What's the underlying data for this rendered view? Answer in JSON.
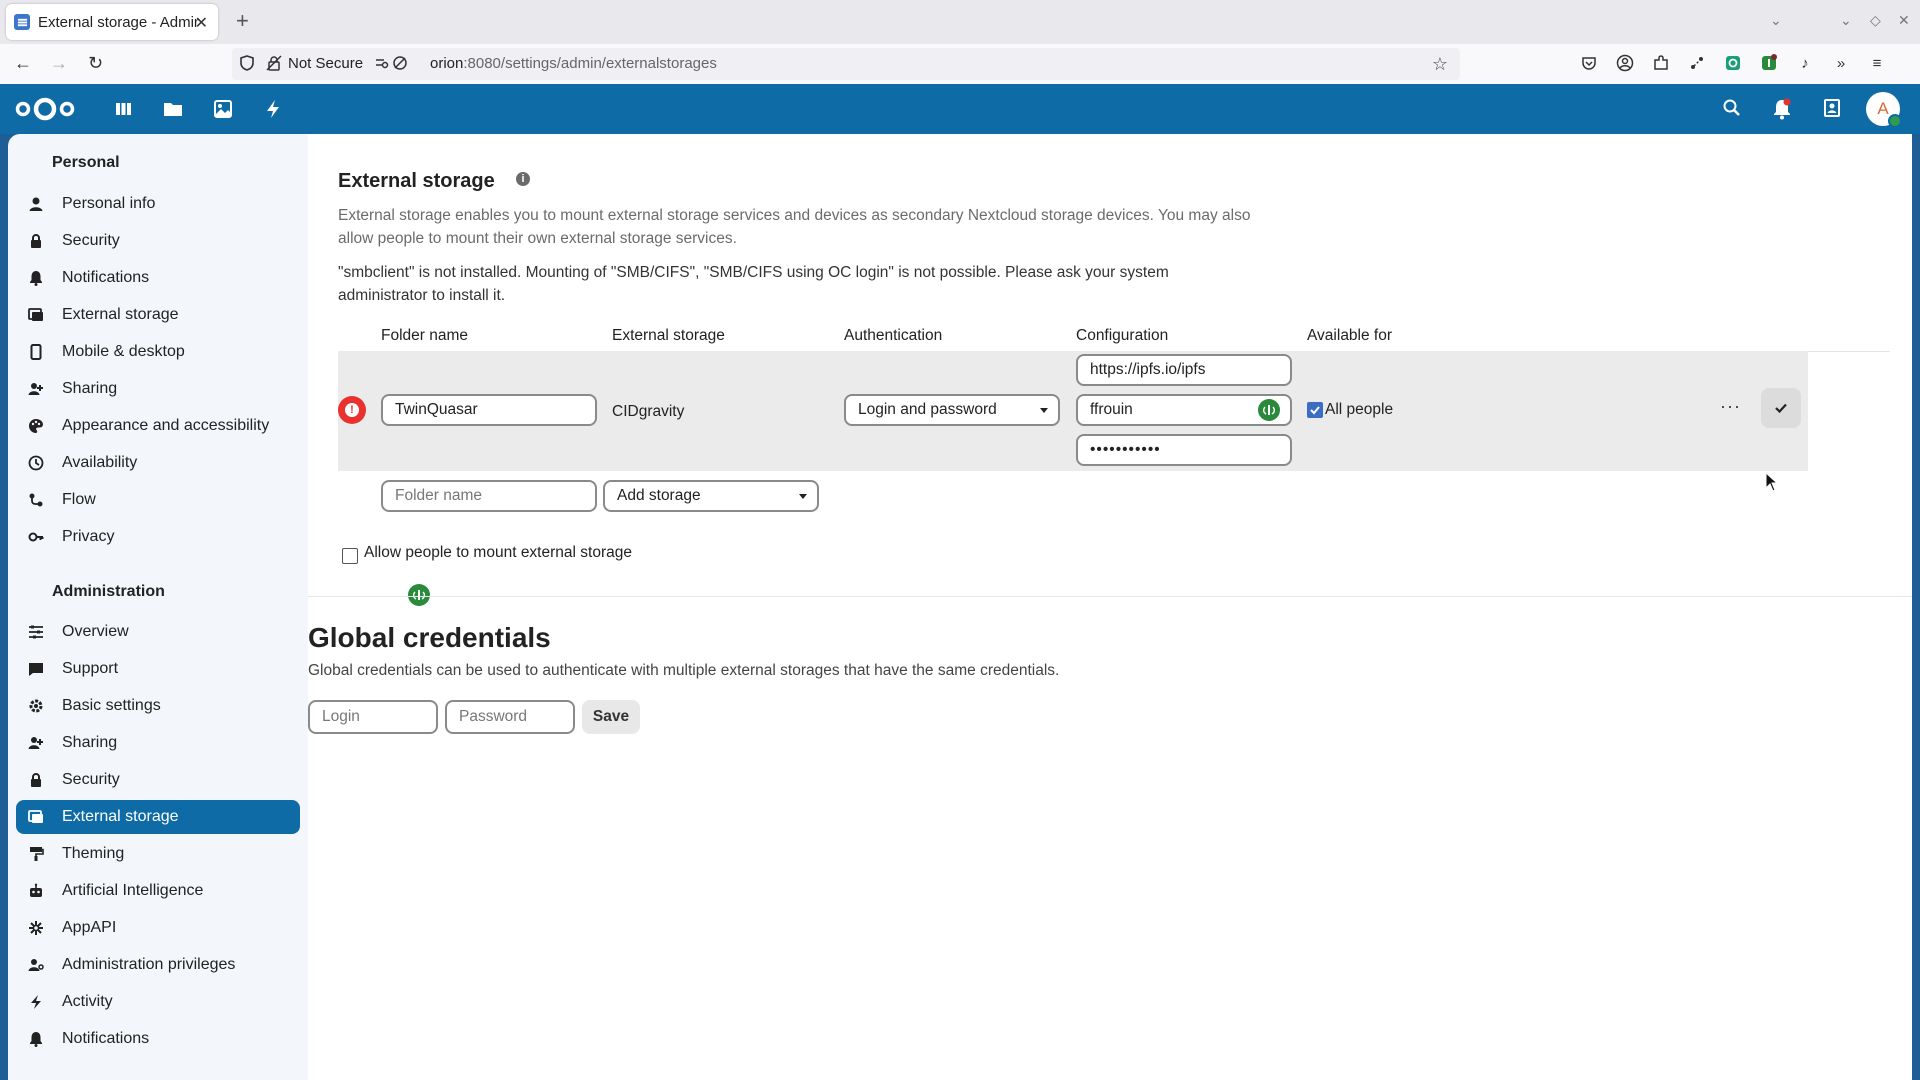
{
  "browser": {
    "tab_title": "External storage - Administ",
    "url_security": "Not Secure",
    "url_host": "orion",
    "url_rest": ":8080/settings/admin/externalstorages"
  },
  "header": {
    "avatar_letter": "A"
  },
  "sidebar": {
    "personal_heading": "Personal",
    "personal_items": [
      {
        "label": "Personal info",
        "icon": "person-icon"
      },
      {
        "label": "Security",
        "icon": "lock-icon"
      },
      {
        "label": "Notifications",
        "icon": "bell-icon"
      },
      {
        "label": "External storage",
        "icon": "external-storage-icon"
      },
      {
        "label": "Mobile & desktop",
        "icon": "phone-icon"
      },
      {
        "label": "Sharing",
        "icon": "share-icon"
      },
      {
        "label": "Appearance and accessibility",
        "icon": "palette-icon"
      },
      {
        "label": "Availability",
        "icon": "clock-icon"
      },
      {
        "label": "Flow",
        "icon": "flow-icon"
      },
      {
        "label": "Privacy",
        "icon": "key-icon"
      }
    ],
    "admin_heading": "Administration",
    "admin_items": [
      {
        "label": "Overview",
        "icon": "overview-icon"
      },
      {
        "label": "Support",
        "icon": "support-icon"
      },
      {
        "label": "Basic settings",
        "icon": "settings-icon"
      },
      {
        "label": "Sharing",
        "icon": "share-icon"
      },
      {
        "label": "Security",
        "icon": "lock-icon"
      },
      {
        "label": "External storage",
        "icon": "external-storage-icon",
        "active": true
      },
      {
        "label": "Theming",
        "icon": "brush-icon"
      },
      {
        "label": "Artificial Intelligence",
        "icon": "robot-icon"
      },
      {
        "label": "AppAPI",
        "icon": "appapi-icon"
      },
      {
        "label": "Administration privileges",
        "icon": "admin-privileges-icon"
      },
      {
        "label": "Activity",
        "icon": "lightning-icon"
      },
      {
        "label": "Notifications",
        "icon": "bell-icon"
      }
    ]
  },
  "main": {
    "title": "External storage",
    "description": "External storage enables you to mount external storage services and devices as secondary Nextcloud storage devices. You may also allow people to mount their own external storage services.",
    "warning": "\"smbclient\" is not installed. Mounting of \"SMB/CIFS\", \"SMB/CIFS using OC login\" is not possible. Please ask your system administrator to install it.",
    "columns": {
      "folder_name": "Folder name",
      "external_storage": "External storage",
      "authentication": "Authentication",
      "configuration": "Configuration",
      "available_for": "Available for"
    },
    "mount": {
      "folder_name": "TwinQuasar",
      "backend": "CIDgravity",
      "auth": "Login and password",
      "config_url": "https://ipfs.io/ipfs",
      "login": "ffrouin",
      "password_mask": "•••••••••••",
      "available_for": "All people"
    },
    "new_mount": {
      "folder_placeholder": "Folder name",
      "add_storage": "Add storage"
    },
    "allow_user_mount": "Allow people to mount external storage",
    "global_credentials": {
      "title": "Global credentials",
      "description": "Global credentials can be used to authenticate with multiple external storages that have the same credentials.",
      "login_placeholder": "Login",
      "password_placeholder": "Password",
      "save_label": "Save"
    }
  },
  "colors": {
    "brand": "#0f6ba6",
    "error": "#e9322d",
    "password_manager": "#2a8a3c"
  }
}
